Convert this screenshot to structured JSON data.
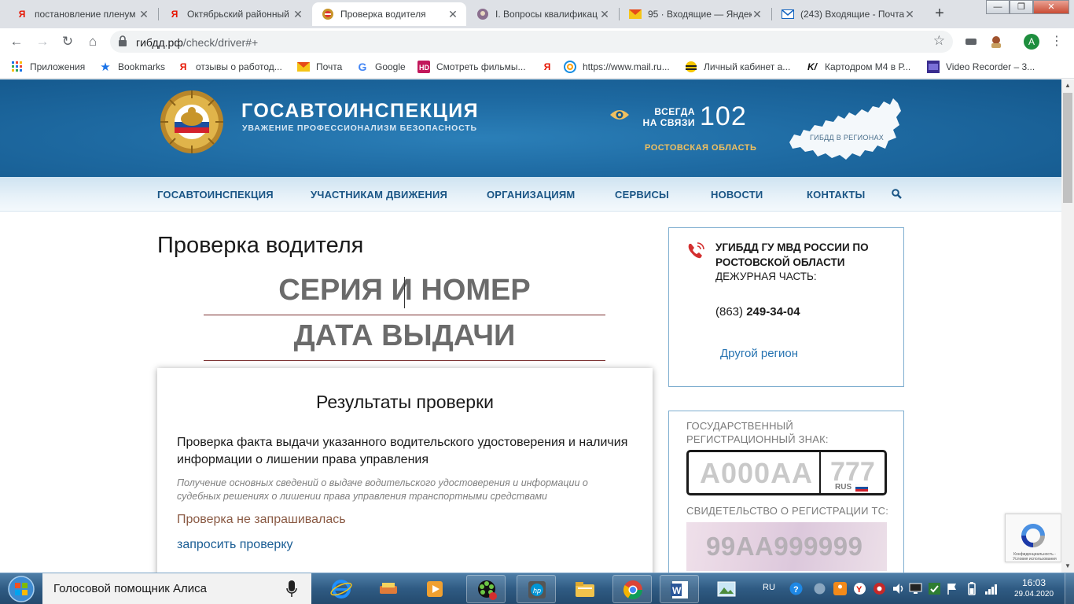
{
  "browser": {
    "tabs": [
      {
        "title": "постановление пленум",
        "icon": "yandex-icon",
        "close": "✕"
      },
      {
        "title": "Октябрьский районный",
        "icon": "yandex-icon",
        "close": "✕"
      },
      {
        "title": "Проверка водителя",
        "icon": "gibdd-emblem-icon",
        "close": "✕",
        "active": true
      },
      {
        "title": "I. Вопросы квалификац",
        "icon": "court-icon",
        "close": "✕"
      },
      {
        "title": "95 · Входящие — Яндек",
        "icon": "yandex-mail-icon",
        "close": "✕"
      },
      {
        "title": "(243) Входящие - Почта",
        "icon": "mail-icon",
        "close": "✕"
      }
    ],
    "new_tab": "+",
    "window_buttons": {
      "minimize": "—",
      "maximize": "❐",
      "close": "✕"
    },
    "url_host": "гибдд.рф",
    "url_path": "/check/driver#+",
    "avatar_letter": "A",
    "bookmarks": [
      {
        "label": "Приложения",
        "icon": "apps-grid-icon"
      },
      {
        "label": "Bookmarks",
        "icon": "star-icon"
      },
      {
        "label": "отзывы о работод...",
        "icon": "yandex-icon"
      },
      {
        "label": "Почта",
        "icon": "mail-envelope-icon"
      },
      {
        "label": "Google",
        "icon": "google-icon"
      },
      {
        "label": "Смотреть фильмы...",
        "icon": "hd-icon"
      },
      {
        "label": "",
        "icon": "yandex-icon"
      },
      {
        "label": "https://www.mail.ru...",
        "icon": "mailru-icon"
      },
      {
        "label": "Личный кабинет а...",
        "icon": "beeline-icon"
      },
      {
        "label": "Картодром М4 в Р...",
        "icon": "karting-icon"
      },
      {
        "label": "Video Recorder – 3...",
        "icon": "video-recorder-icon"
      }
    ]
  },
  "site": {
    "brand_title": "ГОСАВТОИНСПЕКЦИЯ",
    "brand_subtitle": "УВАЖЕНИЕ ПРОФЕССИОНАЛИЗМ БЕЗОПАСНОСТЬ",
    "always_line1": "ВСЕГДА",
    "always_line2": "НА СВЯЗИ",
    "hotline": "102",
    "region": "РОСТОВСКАЯ ОБЛАСТЬ",
    "map_label": "ГИБДД В РЕГИОНАХ",
    "nav": [
      "ГОСАВТОИНСПЕКЦИЯ",
      "УЧАСТНИКАМ ДВИЖЕНИЯ",
      "ОРГАНИЗАЦИЯМ",
      "СЕРВИСЫ",
      "НОВОСТИ",
      "КОНТАКТЫ"
    ]
  },
  "main": {
    "page_title": "Проверка водителя",
    "field_series": "СЕРИЯ И НОМЕР",
    "field_date": "ДАТА ВЫДАЧИ",
    "results": {
      "title": "Результаты проверки",
      "description": "Проверка факта выдачи указанного водительского удостоверения и наличия информации о лишении права управления",
      "note": "Получение основных сведений о выдаче водительского удостоверения и информации о судебных решениях о лишении права управления транспортными средствами",
      "status": "Проверка не запрашивалась",
      "request_link": "запросить проверку"
    }
  },
  "sidebar": {
    "dept_title": "УГИБДД ГУ МВД РОССИИ ПО РОСТОВСКОЙ ОБЛАСТИ",
    "duty_label": "ДЕЖУРНАЯ ЧАСТЬ:",
    "phone_code": "(863)",
    "phone_number": "249-34-04",
    "other_region": "Другой регион",
    "plate_label": "ГОСУДАРСТВЕННЫЙ РЕГИСТРАЦИОННЫЙ ЗНАК:",
    "plate_number": "А000АА",
    "plate_region": "777",
    "plate_rus": "RUS",
    "cert_label": "СВИДЕТЕЛЬСТВО О РЕГИСТРАЦИИ ТС:",
    "cert_number": "99АА999999",
    "recaptcha_text": "Конфиденциальность - Условия использования"
  },
  "taskbar": {
    "alice_text": "Голосовой помощник Алиса",
    "apps": [
      "internet-explorer-icon",
      "disk-burner-icon",
      "media-player-icon",
      "icq-icon",
      "hp-icon",
      "file-explorer-icon",
      "chrome-icon",
      "word-icon",
      "photo-viewer-icon"
    ],
    "lang": "RU",
    "time": "16:03",
    "date": "29.04.2020"
  },
  "colors": {
    "header_blue": "#1e6aa2",
    "nav_text": "#1a5585",
    "link_blue": "#2673b1",
    "field_line": "#7a2e2e",
    "accent_gold": "#f0c060"
  }
}
